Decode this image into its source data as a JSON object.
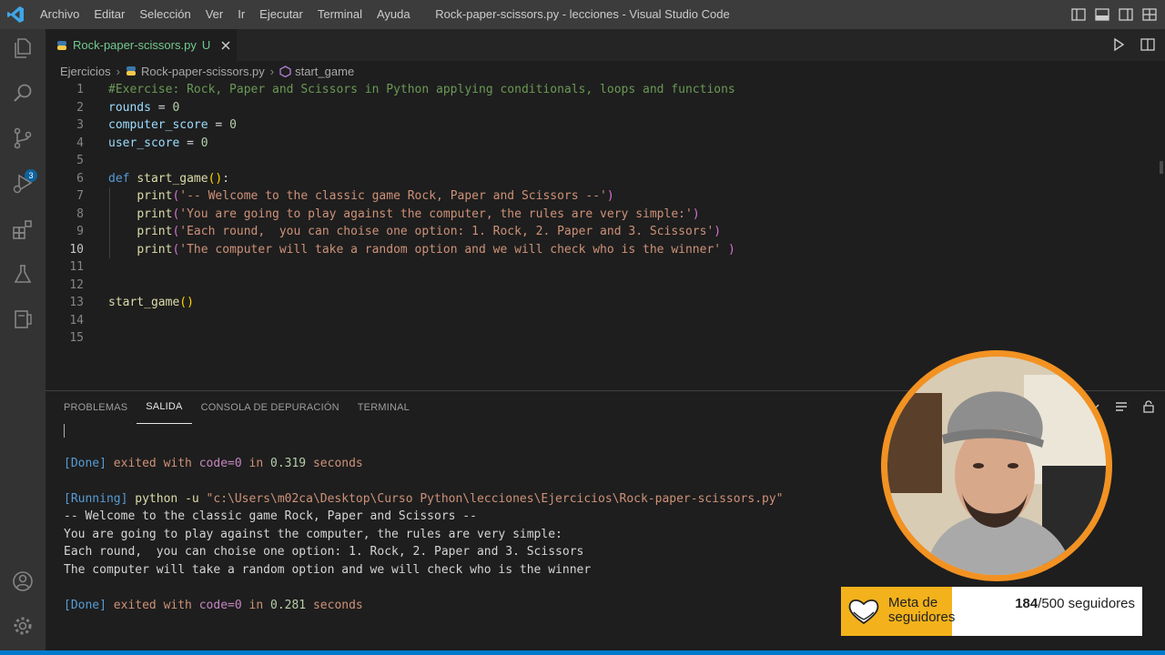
{
  "window": {
    "title": "Rock-paper-scissors.py - lecciones - Visual Studio Code",
    "menu": [
      "Archivo",
      "Editar",
      "Selección",
      "Ver",
      "Ir",
      "Ejecutar",
      "Terminal",
      "Ayuda"
    ]
  },
  "activity_bar": {
    "items": [
      "files-icon",
      "search-icon",
      "source-control-icon",
      "run-debug-icon",
      "extensions-icon",
      "testing-icon",
      "remote-explorer-icon"
    ],
    "source_control_badge": "3",
    "bottom": [
      "account-icon",
      "settings-gear-icon"
    ]
  },
  "tab": {
    "label": "Rock-paper-scissors.py",
    "status": "U"
  },
  "breadcrumb": {
    "folder": "Ejercicios",
    "file": "Rock-paper-scissors.py",
    "symbol": "start_game"
  },
  "editor": {
    "active_line": 10,
    "line_numbers": [
      "1",
      "2",
      "3",
      "4",
      "5",
      "6",
      "7",
      "8",
      "9",
      "10",
      "11",
      "12",
      "13",
      "14",
      "15"
    ],
    "lines": [
      "#Exercise: Rock, Paper and Scissors in Python applying conditionals, loops and functions",
      "rounds = 0",
      "computer_score = 0",
      "user_score = 0",
      "",
      "def start_game():",
      "    print('-- Welcome to the classic game Rock, Paper and Scissors --')",
      "    print('You are going to play against the computer, the rules are very simple:')",
      "    print('Each round,  you can choise one option: 1. Rock, 2. Paper and 3. Scissors')",
      "    print('The computer will take a random option and we will check who is the winner' )",
      "",
      "",
      "start_game()",
      "",
      ""
    ]
  },
  "panel": {
    "tabs": [
      "PROBLEMAS",
      "SALIDA",
      "CONSOLA DE DEPURACIÓN",
      "TERMINAL"
    ],
    "active_tab": "SALIDA",
    "output": {
      "done1": {
        "tag": "[Done]",
        "text1": " exited with ",
        "code": "code=0",
        "text2": " in ",
        "time": "0.319",
        "text3": " seconds"
      },
      "running": {
        "tag": "[Running]",
        "cmd": " python -u ",
        "path": "\"c:\\Users\\m02ca\\Desktop\\Curso Python\\lecciones\\Ejercicios\\Rock-paper-scissors.py\""
      },
      "lines": [
        "-- Welcome to the classic game Rock, Paper and Scissors --",
        "You are going to play against the computer, the rules are very simple:",
        "Each round,  you can choise one option: 1. Rock, 2. Paper and 3. Scissors",
        "The computer will take a random option and we will check who is the winner"
      ],
      "done2": {
        "tag": "[Done]",
        "text1": " exited with ",
        "code": "code=0",
        "text2": " in ",
        "time": "0.281",
        "text3": " seconds"
      }
    }
  },
  "follower_goal": {
    "label": "Meta de seguidores",
    "current": "184",
    "target": "/500 seguidores",
    "progress": 0.368
  },
  "colors": {
    "accent": "#007acc",
    "webcam_ring": "#f29222",
    "goal_fill": "#f3b21b"
  }
}
